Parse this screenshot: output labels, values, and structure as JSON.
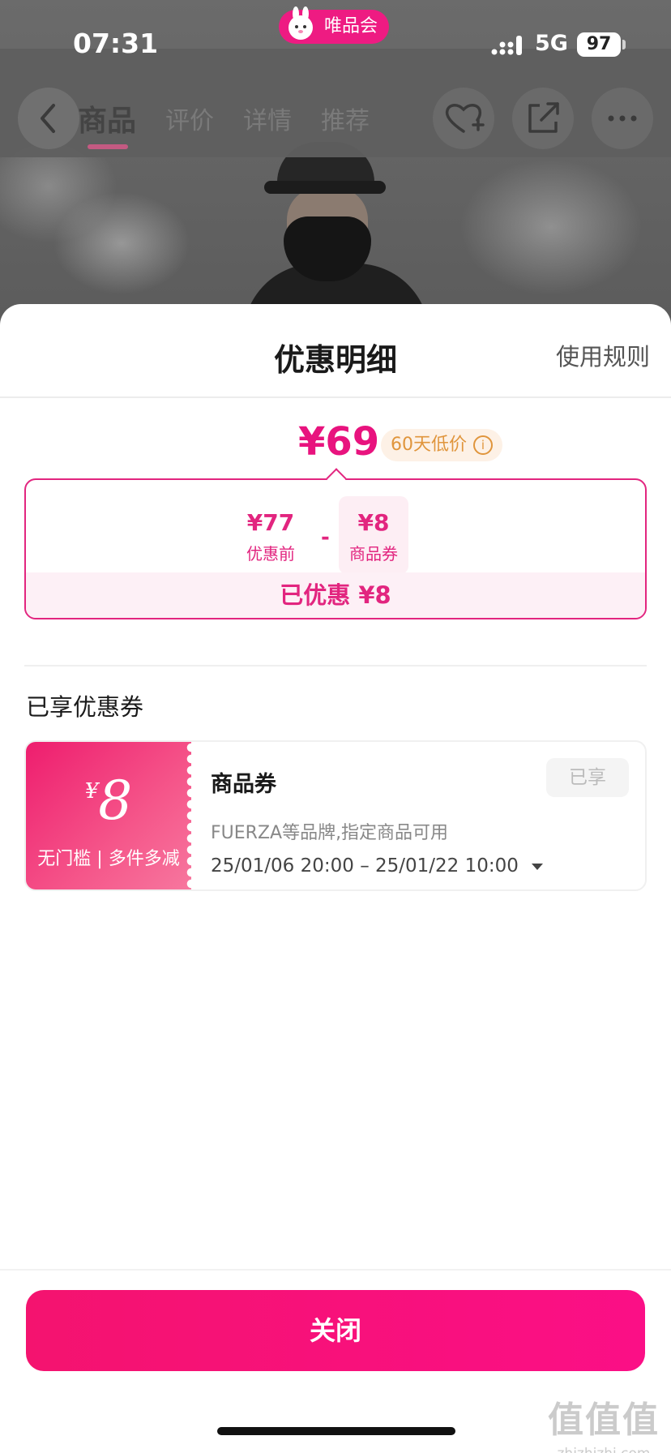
{
  "status_bar": {
    "time": "07:31",
    "app_name": "唯品会",
    "network": "5G",
    "battery": "97"
  },
  "background_nav": {
    "tabs": [
      {
        "label": "商品",
        "active": true
      },
      {
        "label": "评价",
        "active": false
      },
      {
        "label": "详情",
        "active": false
      },
      {
        "label": "推荐",
        "active": false
      }
    ],
    "icons": [
      "back-icon",
      "favorite-add-icon",
      "share-icon",
      "more-icon"
    ]
  },
  "sheet": {
    "title": "优惠明细",
    "rules_link": "使用规则",
    "final_price": "¥69",
    "low_price_badge": "60天低价",
    "breakdown": {
      "original_amount": "¥77",
      "original_label": "优惠前",
      "operator": "-",
      "coupon_amount": "¥8",
      "coupon_label": "商品券"
    },
    "saved_text": "已优惠 ¥8"
  },
  "coupons_section": {
    "title": "已享优惠券",
    "coupons": [
      {
        "currency": "¥",
        "value": "8",
        "condition": "无门槛 | 多件多减",
        "name": "商品券",
        "status": "已享",
        "description": "FUERZA等品牌,指定商品可用",
        "validity": "25/01/06 20:00 – 25/01/22 10:00"
      }
    ]
  },
  "footer": {
    "close_label": "关闭"
  },
  "watermark": {
    "big": "值值值",
    "small": "zhizhizhi.com"
  },
  "colors": {
    "brand": "#ee1b82",
    "accent": "#e2257f",
    "badge_text": "#e0953c",
    "badge_bg": "#fdf1e6"
  }
}
